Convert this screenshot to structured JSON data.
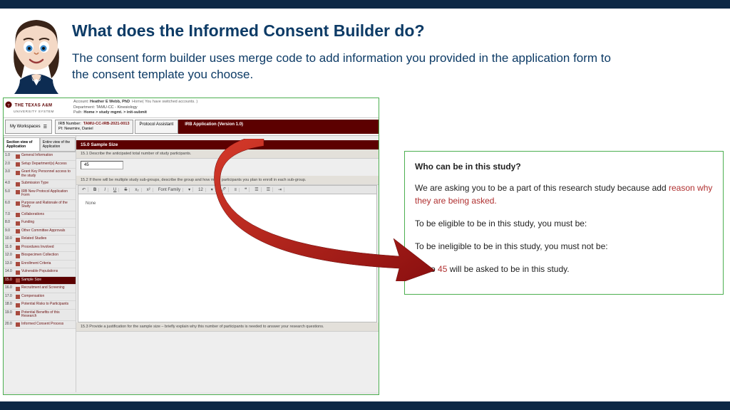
{
  "title": "What does the Informed Consent Builder do?",
  "subtitle": "The consent form builder uses merge code to add information you provided in the application form to the consent template you choose.",
  "app": {
    "logo": {
      "main": "THE TEXAS A&M",
      "sub": "UNIVERSITY SYSTEM"
    },
    "account": {
      "label": "Account:",
      "name": "Heather E Webb, PhD",
      "home": "Home( You have switched accounts. )",
      "dept_label": "Department:",
      "dept": "TAMU-CC - Kinesiology",
      "path_label": "Path:",
      "path": "Home > study mgmt. > init-submit"
    },
    "workspaces": "My Workspaces",
    "irb": {
      "num_label": "IRB Number:",
      "num": "TAMU-CC-IRB-2021-0013",
      "pi_label": "PI:",
      "pi": "Newmire, Daniel"
    },
    "tab1": "Protocol Assistant",
    "tab2": "IRB Application (Version 1.0)",
    "view_tab_active": "Section view of Application",
    "view_tab_inactive": "Entire view of the Application",
    "sidebar": [
      {
        "n": "1.0",
        "t": "General Information"
      },
      {
        "n": "2.0",
        "t": "Setup Department(s) Access"
      },
      {
        "n": "3.0",
        "t": "Grant Key Personnel access to the study"
      },
      {
        "n": "4.0",
        "t": "Submission Type"
      },
      {
        "n": "5.0",
        "t": "IRB New Protocol Application Form"
      },
      {
        "n": "6.0",
        "t": "Purpose and Rationale of the Study"
      },
      {
        "n": "7.0",
        "t": "Collaborations"
      },
      {
        "n": "8.0",
        "t": "Funding"
      },
      {
        "n": "9.0",
        "t": "Other Committee Approvals"
      },
      {
        "n": "10.0",
        "t": "Related Studies"
      },
      {
        "n": "11.0",
        "t": "Procedures Involved"
      },
      {
        "n": "12.0",
        "t": "Biospecimen Collection"
      },
      {
        "n": "13.0",
        "t": "Enrollment Criteria"
      },
      {
        "n": "14.0",
        "t": "Vulnerable Populations"
      },
      {
        "n": "15.0",
        "t": "Sample Size"
      },
      {
        "n": "16.0",
        "t": "Recruitment and Screening"
      },
      {
        "n": "17.0",
        "t": "Compensation"
      },
      {
        "n": "18.0",
        "t": "Potential Risks to Participants"
      },
      {
        "n": "19.0",
        "t": "Potential Benefits of this Research"
      },
      {
        "n": "20.0",
        "t": "Informed Consent Process"
      }
    ],
    "section": {
      "header": "15.0   Sample Size",
      "q1": "15.1   Describe the anticipated total number of study participants.",
      "q1_value": "45",
      "q2": "15.2   If there will be multiple study sub-groups, describe the group and how many participants you plan to enroll in each sub-group.",
      "q2_body": "None",
      "q3": "15.3   Provide a justification for the sample size – briefly explain why this number of participants is needed to answer your research questions.",
      "toolbar": {
        "font_label": "Font Family",
        "size": "12"
      }
    }
  },
  "consent": {
    "heading": "Who can be in this study?",
    "p1a": "We are asking you to be a part of this research study because add ",
    "p1_merge": "reason why they are being asked.",
    "p2": "To be eligible to be in this study, you must be:",
    "p3": "To be ineligible to be in this study, you must not be:",
    "p4a": "Up to ",
    "p4_merge": "45",
    "p4b": " will be asked to be in this study."
  }
}
